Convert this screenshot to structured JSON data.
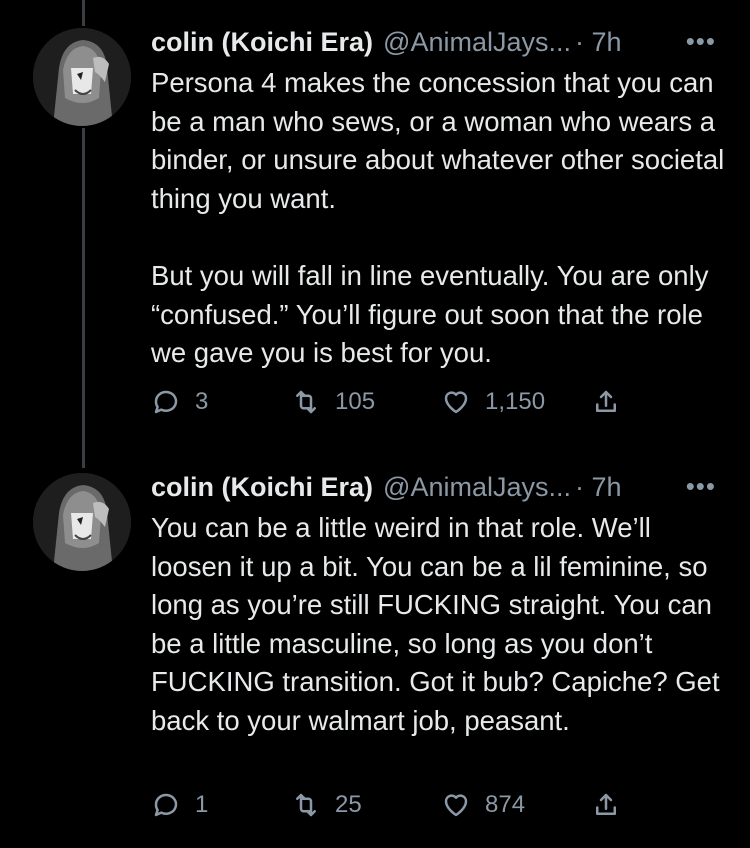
{
  "tweets": [
    {
      "author_name": "colin (Koichi Era)",
      "handle": "@AnimalJays...",
      "time": "· 7h",
      "more": "•••",
      "paragraphs": [
        "Persona 4 makes the concession that you can be a man who sews, or a woman who wears a binder, or unsure about whatever other societal thing you want.",
        "But you will fall in line eventually. You are only “confused.” You’ll figure out soon that the role we gave you is best for you."
      ],
      "replies": "3",
      "retweets": "105",
      "likes": "1,150"
    },
    {
      "author_name": "colin (Koichi Era)",
      "handle": "@AnimalJays...",
      "time": "· 7h",
      "more": "•••",
      "paragraphs": [
        "You can be a little weird in that role. We’ll loosen it up a bit. You can be a lil feminine, so long as you’re still FUCKING straight. You can be a little masculine, so long as you don’t FUCKING transition. Got it bub? Capiche? Get back to your walmart job, peasant."
      ],
      "replies": "1",
      "retweets": "25",
      "likes": "874"
    }
  ],
  "colors": {
    "background": "#000000",
    "text": "#e7e9ea",
    "muted": "#8b98a5",
    "thread_line": "#3a3d41"
  },
  "icons": {
    "reply": "reply-icon",
    "retweet": "retweet-icon",
    "like": "heart-icon",
    "share": "share-icon"
  }
}
